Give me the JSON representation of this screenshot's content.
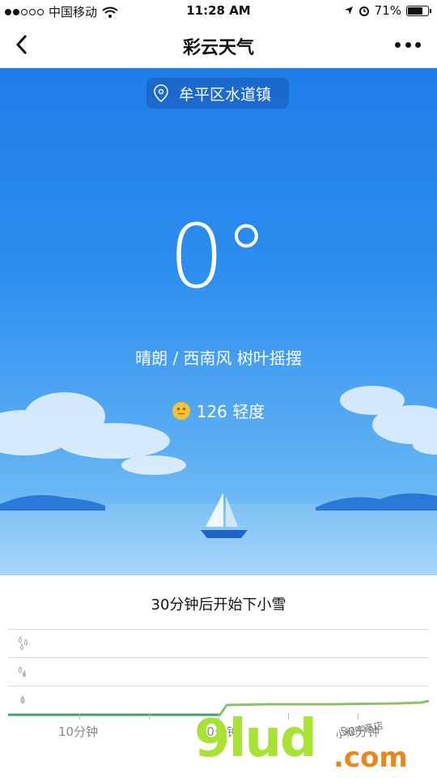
{
  "status_bar": {
    "carrier": "中国移动",
    "time": "11:28 AM",
    "battery": "71%",
    "battery_level": 0.71
  },
  "nav": {
    "title": "彩云天气"
  },
  "weather": {
    "location": "牟平区水道镇",
    "temperature": "0°",
    "description": "晴朗 / 西南风 树叶摇摆",
    "aqi": "126 轻度"
  },
  "forecast": {
    "title": "30分钟后开始下小雪",
    "x_ticks": [
      "10分钟",
      "30分钟",
      "50分钟"
    ]
  },
  "watermark": {
    "main": "9lud",
    "suffix": ".com",
    "tag": "小程序商店"
  },
  "colors": {
    "sky_top": "#1f7de8",
    "sky_bottom": "#8fcaf6",
    "precip_line": "#8cc06a",
    "aqi_face": "#f5c230"
  }
}
